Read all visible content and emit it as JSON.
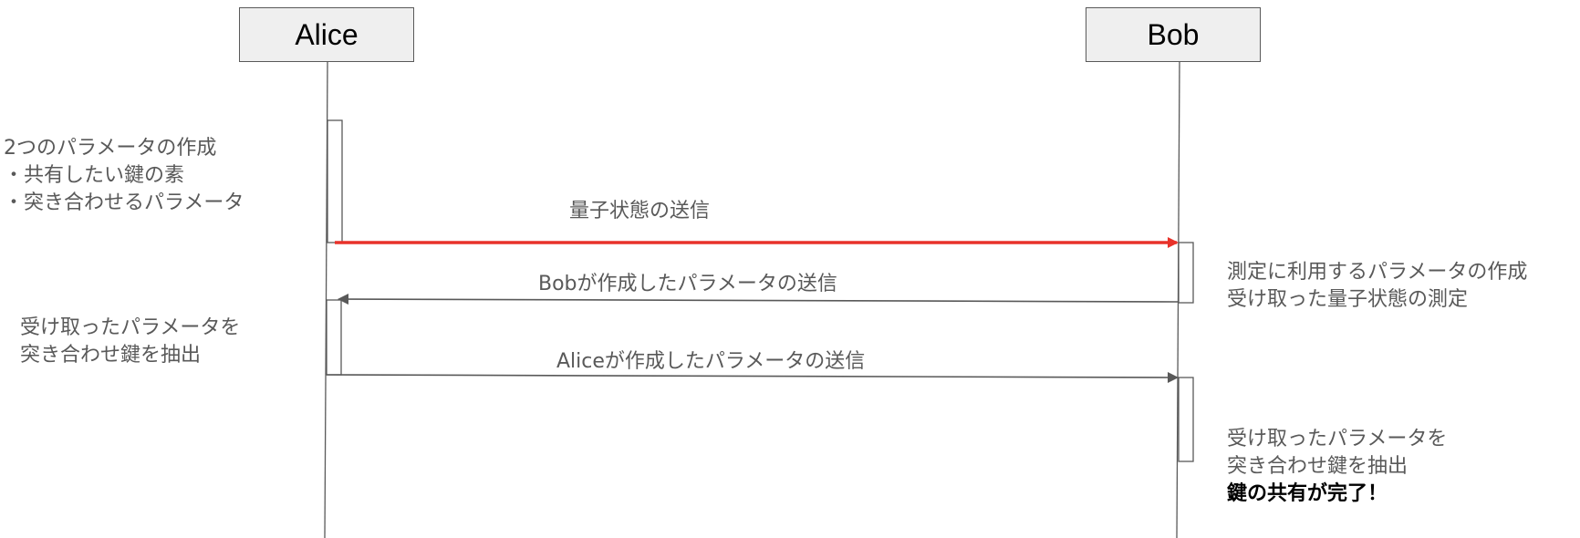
{
  "participants": {
    "alice": "Alice",
    "bob": "Bob"
  },
  "messages": [
    {
      "label": "量子状態の送信",
      "from": "alice",
      "to": "bob",
      "color": "#e8322a"
    },
    {
      "label": "Bobが作成したパラメータの送信",
      "from": "bob",
      "to": "alice",
      "color": "#595959"
    },
    {
      "label": "Aliceが作成したパラメータの送信",
      "from": "alice",
      "to": "bob",
      "color": "#595959"
    }
  ],
  "notes": {
    "alice_create": {
      "lines": [
        "2つのパラメータの作成",
        "・共有したい鍵の素",
        "・突き合わせるパラメータ"
      ]
    },
    "alice_extract": {
      "lines": [
        "受け取ったパラメータを",
        "突き合わせ鍵を抽出"
      ]
    },
    "bob_measure": {
      "lines": [
        "測定に利用するパラメータの作成",
        "受け取った量子状態の測定"
      ]
    },
    "bob_extract": {
      "lines": [
        "受け取ったパラメータを",
        "突き合わせ鍵を抽出"
      ],
      "emphasis": "鍵の共有が完了！"
    }
  },
  "colors": {
    "line": "#595959",
    "quantum_arrow": "#e8322a",
    "participant_fill": "#efefef"
  }
}
